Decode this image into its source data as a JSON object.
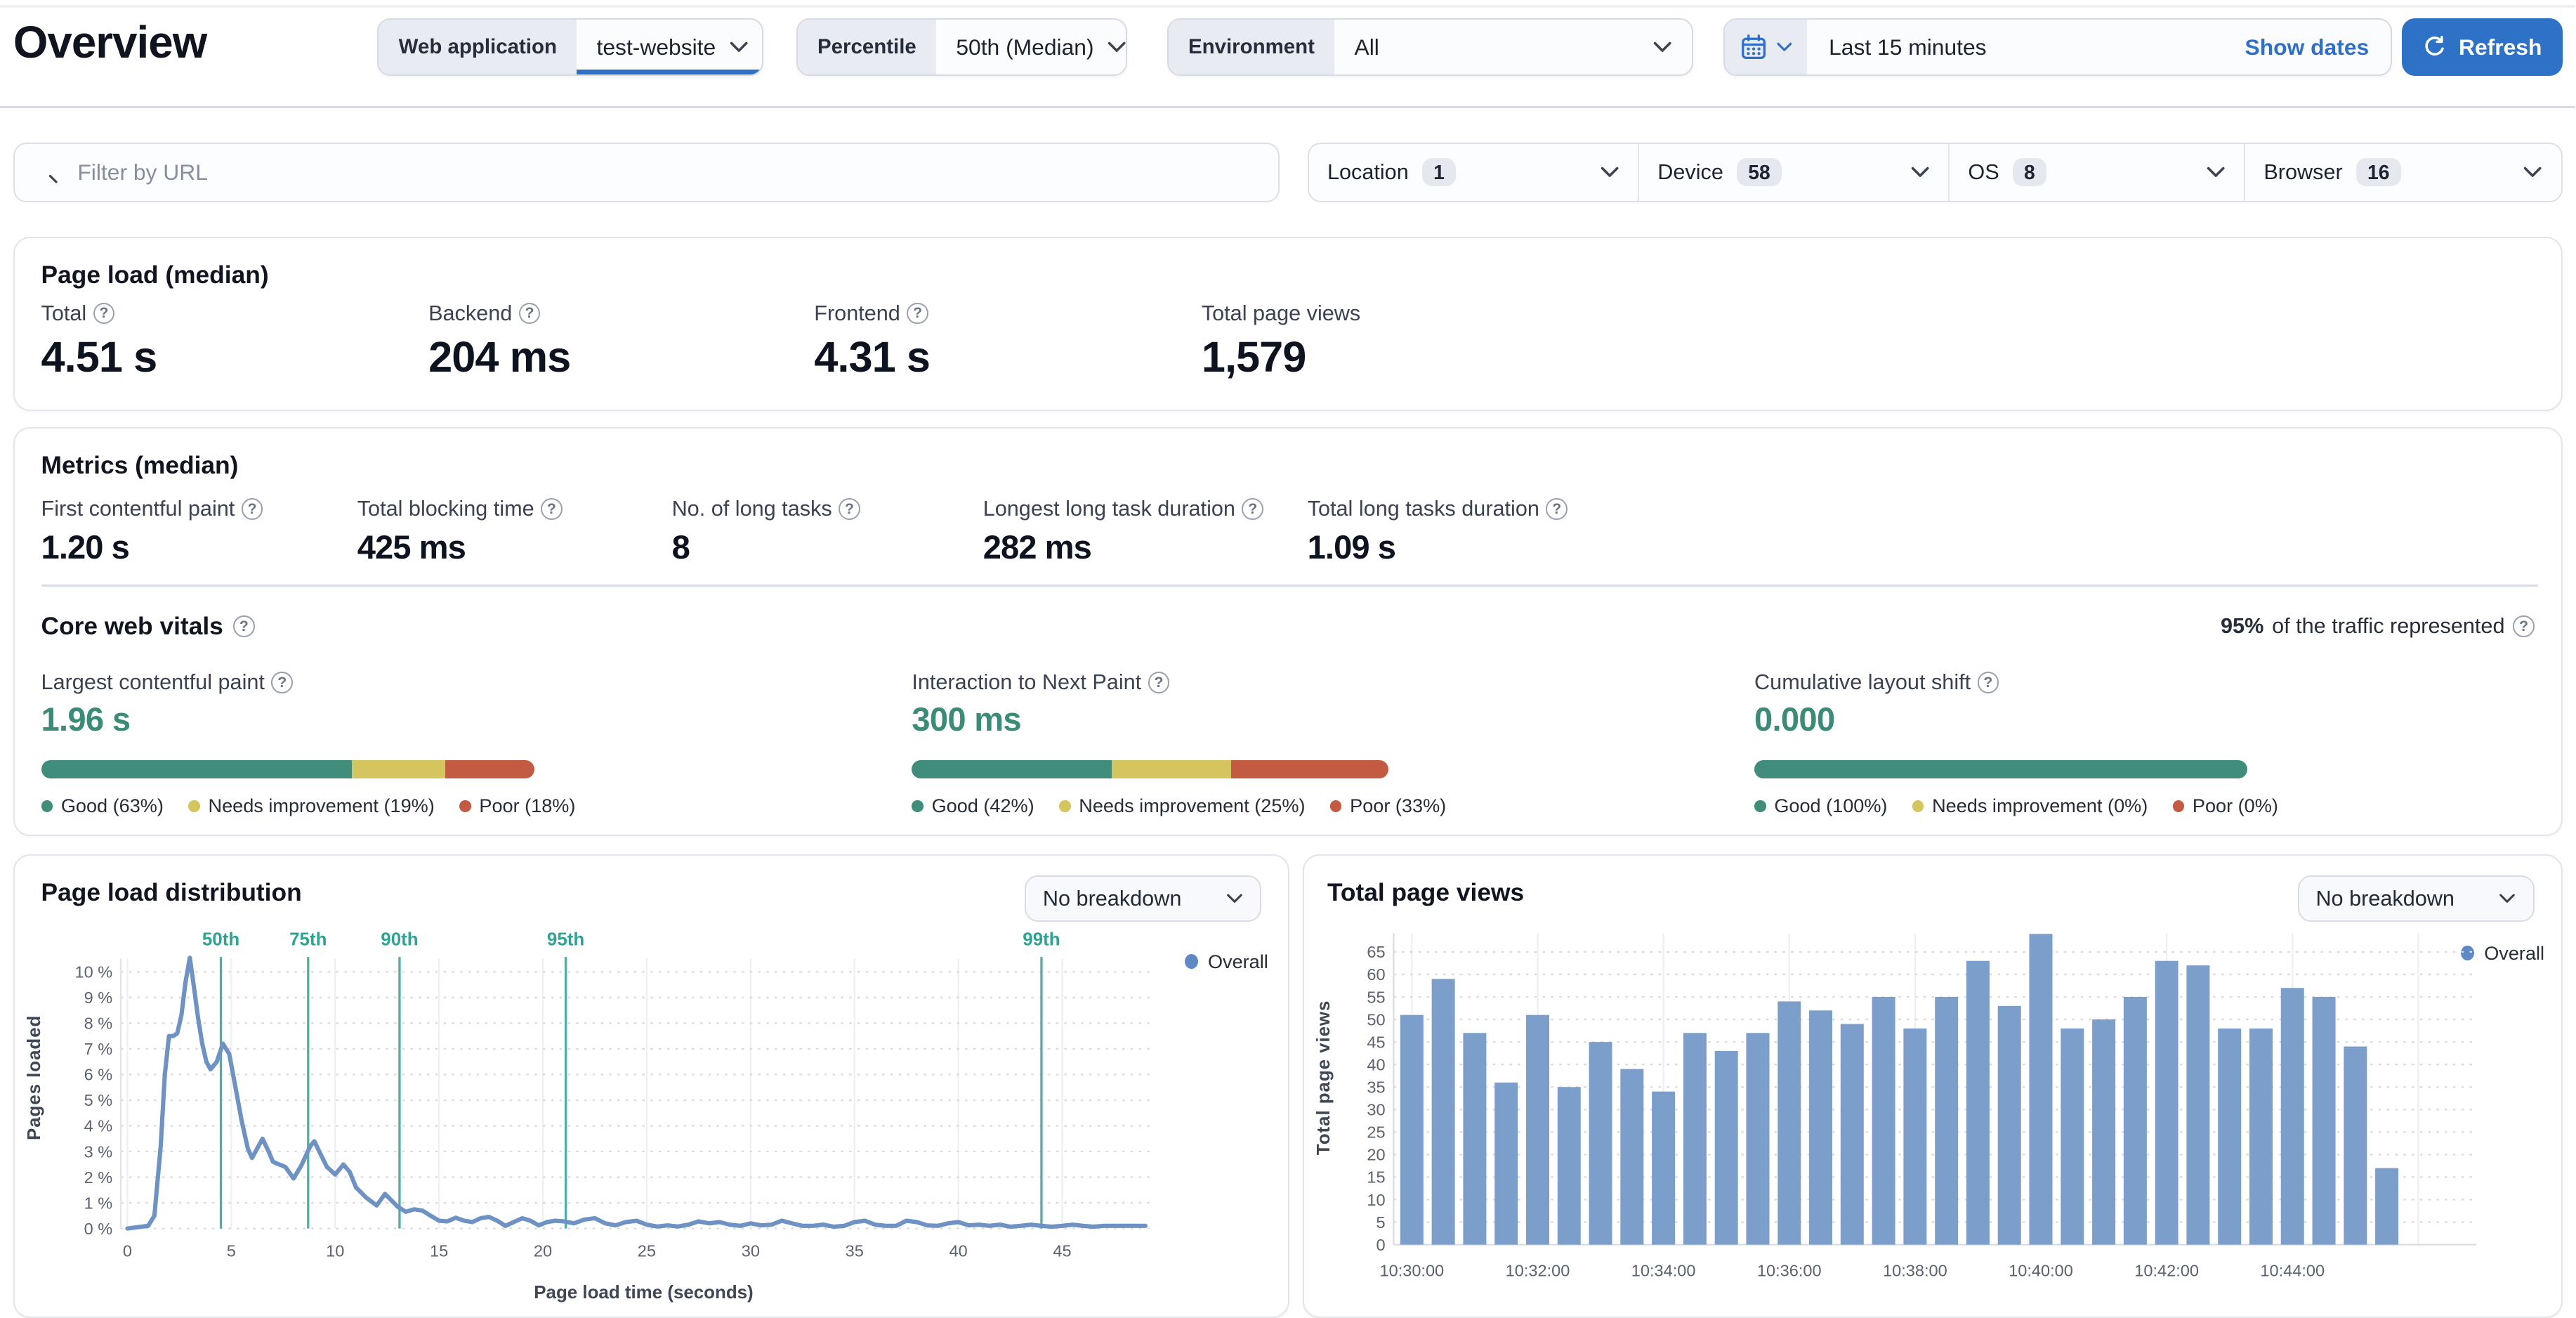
{
  "header": {
    "title": "Overview",
    "filters": {
      "web_application": {
        "label": "Web application",
        "value": "test-website"
      },
      "percentile": {
        "label": "Percentile",
        "value": "50th (Median)"
      },
      "environment": {
        "label": "Environment",
        "value": "All"
      }
    },
    "date_range": {
      "value": "Last 15 minutes",
      "show_dates_label": "Show dates"
    },
    "refresh_label": "Refresh"
  },
  "filter_bar": {
    "search_placeholder": "Filter by URL",
    "facets": [
      {
        "label": "Location",
        "count": "1"
      },
      {
        "label": "Device",
        "count": "58"
      },
      {
        "label": "OS",
        "count": "8"
      },
      {
        "label": "Browser",
        "count": "16"
      }
    ]
  },
  "page_load": {
    "title": "Page load (median)",
    "stats": [
      {
        "label": "Total",
        "value": "4.51 s",
        "help": true
      },
      {
        "label": "Backend",
        "value": "204 ms",
        "help": true
      },
      {
        "label": "Frontend",
        "value": "4.31 s",
        "help": true
      },
      {
        "label": "Total page views",
        "value": "1,579",
        "help": false
      }
    ]
  },
  "metrics": {
    "title": "Metrics (median)",
    "stats": [
      {
        "label": "First contentful paint",
        "value": "1.20 s",
        "help": true
      },
      {
        "label": "Total blocking time",
        "value": "425 ms",
        "help": true
      },
      {
        "label": "No. of long tasks",
        "value": "8",
        "help": true
      },
      {
        "label": "Longest long task duration",
        "value": "282 ms",
        "help": true
      },
      {
        "label": "Total long tasks duration",
        "value": "1.09 s",
        "help": true
      }
    ]
  },
  "core_web_vitals": {
    "title": "Core web vitals",
    "traffic_note_strong": "95%",
    "traffic_note_rest": "of the traffic represented",
    "vitals": [
      {
        "label": "Largest contentful paint",
        "value": "1.96 s",
        "segments": [
          63,
          19,
          18
        ],
        "legend": [
          "Good (63%)",
          "Needs improvement (19%)",
          "Poor (18%)"
        ]
      },
      {
        "label": "Interaction to Next Paint",
        "value": "300 ms",
        "segments": [
          42,
          25,
          33
        ],
        "legend": [
          "Good (42%)",
          "Needs improvement (25%)",
          "Poor (33%)"
        ]
      },
      {
        "label": "Cumulative layout shift",
        "value": "0.000",
        "segments": [
          100,
          0,
          0
        ],
        "legend": [
          "Good (100%)",
          "Needs improvement (0%)",
          "Poor (0%)"
        ]
      }
    ]
  },
  "colors": {
    "accent_blue": "#2e72c8",
    "teal_value": "#3a8c77",
    "good_green": "#3f8d7a",
    "warn_yellow": "#d4c55f",
    "poor_red": "#c25b42",
    "line_blue": "#6d92c3",
    "bar_blue": "#7c9ecb",
    "percentile_teal": "#4fb0a1",
    "legend_dot_blue": "#5e88c6"
  },
  "chart_data": [
    {
      "type": "line",
      "title": "Page load distribution",
      "breakdown_selector": "No breakdown",
      "legend": [
        "Overall"
      ],
      "xlabel": "Page load time (seconds)",
      "ylabel": "Pages loaded",
      "xlim": [
        0,
        49
      ],
      "ylim": [
        0,
        10.8
      ],
      "x_ticks": [
        0,
        5,
        10,
        15,
        20,
        25,
        30,
        35,
        40,
        45
      ],
      "y_ticks_pct": [
        0,
        1,
        2,
        3,
        4,
        5,
        6,
        7,
        8,
        9,
        10
      ],
      "grid": true,
      "legend_position": "top-right",
      "percentiles": [
        {
          "label": "50th",
          "x": 4.5
        },
        {
          "label": "75th",
          "x": 8.7
        },
        {
          "label": "90th",
          "x": 13.1
        },
        {
          "label": "95th",
          "x": 21.1
        },
        {
          "label": "99th",
          "x": 44.0
        }
      ],
      "series": [
        {
          "name": "Overall",
          "points": [
            [
              0,
              0
            ],
            [
              0.5,
              0.05
            ],
            [
              1,
              0.1
            ],
            [
              1.3,
              0.5
            ],
            [
              1.6,
              3.2
            ],
            [
              1.8,
              6.0
            ],
            [
              2.0,
              7.5
            ],
            [
              2.2,
              7.5
            ],
            [
              2.4,
              7.6
            ],
            [
              2.6,
              8.3
            ],
            [
              2.8,
              9.6
            ],
            [
              3.0,
              10.55
            ],
            [
              3.2,
              9.4
            ],
            [
              3.4,
              8.2
            ],
            [
              3.6,
              7.2
            ],
            [
              3.8,
              6.5
            ],
            [
              4.0,
              6.2
            ],
            [
              4.3,
              6.5
            ],
            [
              4.6,
              7.2
            ],
            [
              4.9,
              6.8
            ],
            [
              5.2,
              5.5
            ],
            [
              5.5,
              4.2
            ],
            [
              5.8,
              3.1
            ],
            [
              6.0,
              2.75
            ],
            [
              6.3,
              3.2
            ],
            [
              6.5,
              3.5
            ],
            [
              6.8,
              3.0
            ],
            [
              7.0,
              2.6
            ],
            [
              7.3,
              2.5
            ],
            [
              7.6,
              2.4
            ],
            [
              8.0,
              1.95
            ],
            [
              8.4,
              2.5
            ],
            [
              8.8,
              3.2
            ],
            [
              9.0,
              3.4
            ],
            [
              9.3,
              2.9
            ],
            [
              9.6,
              2.4
            ],
            [
              10.0,
              2.1
            ],
            [
              10.4,
              2.5
            ],
            [
              10.7,
              2.2
            ],
            [
              11.0,
              1.6
            ],
            [
              11.5,
              1.2
            ],
            [
              12.0,
              0.9
            ],
            [
              12.4,
              1.35
            ],
            [
              12.7,
              1.1
            ],
            [
              13.0,
              0.85
            ],
            [
              13.4,
              0.65
            ],
            [
              13.8,
              0.75
            ],
            [
              14.2,
              0.7
            ],
            [
              14.6,
              0.5
            ],
            [
              15.0,
              0.3
            ],
            [
              15.4,
              0.28
            ],
            [
              15.8,
              0.42
            ],
            [
              16.2,
              0.3
            ],
            [
              16.6,
              0.25
            ],
            [
              17.0,
              0.4
            ],
            [
              17.4,
              0.45
            ],
            [
              17.8,
              0.3
            ],
            [
              18.2,
              0.1
            ],
            [
              18.6,
              0.25
            ],
            [
              19.0,
              0.4
            ],
            [
              19.4,
              0.3
            ],
            [
              19.8,
              0.12
            ],
            [
              20.2,
              0.25
            ],
            [
              20.6,
              0.3
            ],
            [
              21.0,
              0.28
            ],
            [
              21.5,
              0.2
            ],
            [
              22.0,
              0.35
            ],
            [
              22.5,
              0.4
            ],
            [
              23.0,
              0.2
            ],
            [
              23.5,
              0.12
            ],
            [
              24.0,
              0.25
            ],
            [
              24.5,
              0.3
            ],
            [
              25.0,
              0.15
            ],
            [
              25.5,
              0.08
            ],
            [
              26.0,
              0.12
            ],
            [
              26.5,
              0.08
            ],
            [
              27.0,
              0.15
            ],
            [
              27.5,
              0.28
            ],
            [
              28.0,
              0.2
            ],
            [
              28.5,
              0.25
            ],
            [
              29.0,
              0.15
            ],
            [
              29.5,
              0.1
            ],
            [
              30.0,
              0.2
            ],
            [
              30.5,
              0.12
            ],
            [
              31.0,
              0.15
            ],
            [
              31.5,
              0.3
            ],
            [
              32.0,
              0.2
            ],
            [
              32.5,
              0.1
            ],
            [
              33.0,
              0.1
            ],
            [
              33.5,
              0.15
            ],
            [
              34.0,
              0.07
            ],
            [
              34.5,
              0.1
            ],
            [
              35.0,
              0.25
            ],
            [
              35.5,
              0.3
            ],
            [
              36.0,
              0.15
            ],
            [
              36.5,
              0.1
            ],
            [
              37.0,
              0.1
            ],
            [
              37.5,
              0.3
            ],
            [
              38.0,
              0.25
            ],
            [
              38.5,
              0.12
            ],
            [
              39.0,
              0.1
            ],
            [
              39.5,
              0.2
            ],
            [
              40.0,
              0.25
            ],
            [
              40.5,
              0.12
            ],
            [
              41.0,
              0.15
            ],
            [
              41.5,
              0.1
            ],
            [
              42.0,
              0.15
            ],
            [
              42.5,
              0.07
            ],
            [
              43.0,
              0.1
            ],
            [
              43.5,
              0.15
            ],
            [
              44.0,
              0.1
            ],
            [
              44.5,
              0.07
            ],
            [
              45.0,
              0.1
            ],
            [
              45.5,
              0.15
            ],
            [
              46.0,
              0.1
            ],
            [
              46.5,
              0.07
            ],
            [
              47.0,
              0.1
            ],
            [
              47.5,
              0.1
            ],
            [
              48.0,
              0.1
            ],
            [
              48.5,
              0.1
            ],
            [
              49.0,
              0.1
            ]
          ]
        }
      ]
    },
    {
      "type": "bar",
      "title": "Total page views",
      "breakdown_selector": "No breakdown",
      "legend": [
        "Overall"
      ],
      "xlabel": "",
      "ylabel": "Total page views",
      "ylim": [
        0,
        69
      ],
      "y_ticks": [
        0,
        5,
        10,
        15,
        20,
        25,
        30,
        35,
        40,
        45,
        50,
        55,
        60,
        65
      ],
      "grid": true,
      "legend_position": "top-right",
      "x_tick_labels": [
        "10:30:00",
        "10:32:00",
        "10:34:00",
        "10:36:00",
        "10:38:00",
        "10:40:00",
        "10:42:00",
        "10:44:00"
      ],
      "label_every": 4,
      "interval_seconds": 30,
      "values": [
        51,
        59,
        47,
        36,
        51,
        35,
        45,
        39,
        34,
        47,
        43,
        47,
        54,
        52,
        49,
        55,
        48,
        55,
        63,
        53,
        69,
        48,
        50,
        55,
        63,
        62,
        48,
        48,
        57,
        55,
        44,
        17
      ]
    }
  ]
}
